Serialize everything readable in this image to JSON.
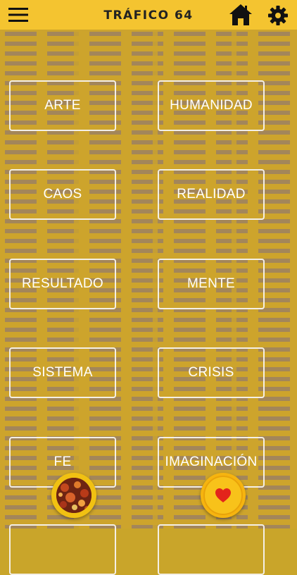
{
  "header": {
    "title": "TRÁFICO 64",
    "icons": {
      "menu": "hamburger-menu-icon",
      "home": "home-icon",
      "settings": "gear-icon"
    }
  },
  "categories": [
    {
      "label": "ARTE"
    },
    {
      "label": "HUMANIDAD"
    },
    {
      "label": "CAOS"
    },
    {
      "label": "REALIDAD"
    },
    {
      "label": "RESULTADO"
    },
    {
      "label": "MENTE"
    },
    {
      "label": "SISTEMA"
    },
    {
      "label": "CRISIS"
    },
    {
      "label": "FE"
    },
    {
      "label": "IMAGINACIÓN"
    }
  ],
  "fabs": {
    "left": "image-thumbnail-icon",
    "right": "heart-icon"
  },
  "colors": {
    "header_bg": "#f4c430",
    "background": "#cda42c",
    "button_border": "#f4efe6",
    "heart": "#e3241b"
  }
}
